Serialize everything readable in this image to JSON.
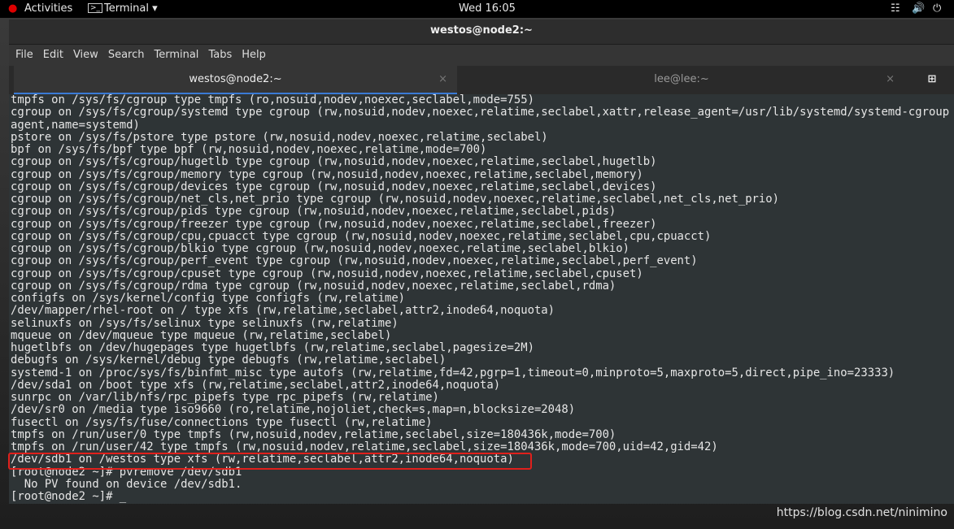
{
  "topbar": {
    "activities": "Activities",
    "app": "Terminal",
    "clock": "Wed 16:05"
  },
  "window": {
    "title": "westos@node2:~",
    "menu": [
      "File",
      "Edit",
      "View",
      "Search",
      "Terminal",
      "Tabs",
      "Help"
    ],
    "tabs": [
      {
        "label": "westos@node2:~",
        "active": true
      },
      {
        "label": "lee@lee:~",
        "active": false
      }
    ]
  },
  "terminal": {
    "lines": [
      "tmpfs on /sys/fs/cgroup type tmpfs (ro,nosuid,nodev,noexec,seclabel,mode=755)",
      "cgroup on /sys/fs/cgroup/systemd type cgroup (rw,nosuid,nodev,noexec,relatime,seclabel,xattr,release_agent=/usr/lib/systemd/systemd-cgroup",
      "agent,name=systemd)",
      "pstore on /sys/fs/pstore type pstore (rw,nosuid,nodev,noexec,relatime,seclabel)",
      "bpf on /sys/fs/bpf type bpf (rw,nosuid,nodev,noexec,relatime,mode=700)",
      "cgroup on /sys/fs/cgroup/hugetlb type cgroup (rw,nosuid,nodev,noexec,relatime,seclabel,hugetlb)",
      "cgroup on /sys/fs/cgroup/memory type cgroup (rw,nosuid,nodev,noexec,relatime,seclabel,memory)",
      "cgroup on /sys/fs/cgroup/devices type cgroup (rw,nosuid,nodev,noexec,relatime,seclabel,devices)",
      "cgroup on /sys/fs/cgroup/net_cls,net_prio type cgroup (rw,nosuid,nodev,noexec,relatime,seclabel,net_cls,net_prio)",
      "cgroup on /sys/fs/cgroup/pids type cgroup (rw,nosuid,nodev,noexec,relatime,seclabel,pids)",
      "cgroup on /sys/fs/cgroup/freezer type cgroup (rw,nosuid,nodev,noexec,relatime,seclabel,freezer)",
      "cgroup on /sys/fs/cgroup/cpu,cpuacct type cgroup (rw,nosuid,nodev,noexec,relatime,seclabel,cpu,cpuacct)",
      "cgroup on /sys/fs/cgroup/blkio type cgroup (rw,nosuid,nodev,noexec,relatime,seclabel,blkio)",
      "cgroup on /sys/fs/cgroup/perf_event type cgroup (rw,nosuid,nodev,noexec,relatime,seclabel,perf_event)",
      "cgroup on /sys/fs/cgroup/cpuset type cgroup (rw,nosuid,nodev,noexec,relatime,seclabel,cpuset)",
      "cgroup on /sys/fs/cgroup/rdma type cgroup (rw,nosuid,nodev,noexec,relatime,seclabel,rdma)",
      "configfs on /sys/kernel/config type configfs (rw,relatime)",
      "/dev/mapper/rhel-root on / type xfs (rw,relatime,seclabel,attr2,inode64,noquota)",
      "selinuxfs on /sys/fs/selinux type selinuxfs (rw,relatime)",
      "mqueue on /dev/mqueue type mqueue (rw,relatime,seclabel)",
      "hugetlbfs on /dev/hugepages type hugetlbfs (rw,relatime,seclabel,pagesize=2M)",
      "debugfs on /sys/kernel/debug type debugfs (rw,relatime,seclabel)",
      "systemd-1 on /proc/sys/fs/binfmt_misc type autofs (rw,relatime,fd=42,pgrp=1,timeout=0,minproto=5,maxproto=5,direct,pipe_ino=23333)",
      "/dev/sda1 on /boot type xfs (rw,relatime,seclabel,attr2,inode64,noquota)",
      "sunrpc on /var/lib/nfs/rpc_pipefs type rpc_pipefs (rw,relatime)",
      "/dev/sr0 on /media type iso9660 (ro,relatime,nojoliet,check=s,map=n,blocksize=2048)",
      "fusectl on /sys/fs/fuse/connections type fusectl (rw,relatime)",
      "tmpfs on /run/user/0 type tmpfs (rw,nosuid,nodev,relatime,seclabel,size=180436k,mode=700)",
      "tmpfs on /run/user/42 type tmpfs (rw,nosuid,nodev,relatime,seclabel,size=180436k,mode=700,uid=42,gid=42)",
      "/dev/sdb1 on /westos type xfs (rw,relatime,seclabel,attr2,inode64,noquota)",
      "[root@node2 ~]# pvremove /dev/sdb1",
      "  No PV found on device /dev/sdb1.",
      "[root@node2 ~]# _"
    ]
  },
  "highlight_color": "#e0201c",
  "watermark": "https://blog.csdn.net/ninimino"
}
